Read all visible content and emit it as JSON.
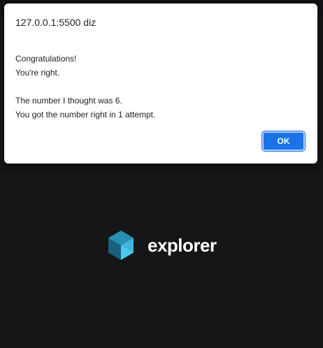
{
  "dialog": {
    "title": "127.0.0.1:5500 diz",
    "message_lines": [
      "Congratulations!",
      "You're right.",
      "",
      "The number I thought was 6.",
      "You got the number right in 1 attempt."
    ],
    "ok_label": "OK"
  },
  "brand": {
    "name": "explorer",
    "logo_icon": "explorer-logo-icon"
  },
  "colors": {
    "background": "#161618",
    "accent": "#1a73e8",
    "logo_light": "#3fb6e0",
    "logo_dark": "#1f6f8f"
  }
}
